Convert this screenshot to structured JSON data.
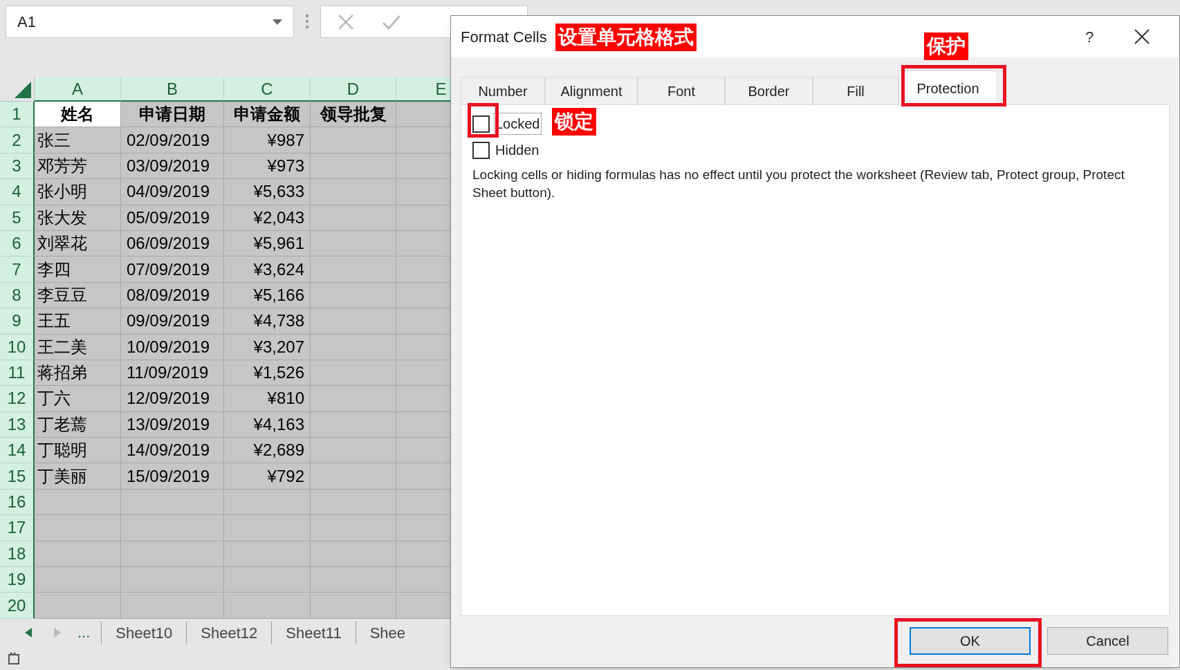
{
  "name_box": {
    "value": "A1"
  },
  "columns": [
    "A",
    "B",
    "C",
    "D",
    "E"
  ],
  "rows": [
    {
      "number": "1",
      "cells": [
        "姓名",
        "申请日期",
        "申请金额",
        "领导批复",
        ""
      ],
      "header": true
    },
    {
      "number": "2",
      "cells": [
        "张三",
        "02/09/2019",
        "¥987",
        "",
        ""
      ]
    },
    {
      "number": "3",
      "cells": [
        "邓芳芳",
        "03/09/2019",
        "¥973",
        "",
        ""
      ]
    },
    {
      "number": "4",
      "cells": [
        "张小明",
        "04/09/2019",
        "¥5,633",
        "",
        ""
      ]
    },
    {
      "number": "5",
      "cells": [
        "张大发",
        "05/09/2019",
        "¥2,043",
        "",
        ""
      ]
    },
    {
      "number": "6",
      "cells": [
        "刘翠花",
        "06/09/2019",
        "¥5,961",
        "",
        ""
      ]
    },
    {
      "number": "7",
      "cells": [
        "李四",
        "07/09/2019",
        "¥3,624",
        "",
        ""
      ]
    },
    {
      "number": "8",
      "cells": [
        "李豆豆",
        "08/09/2019",
        "¥5,166",
        "",
        ""
      ]
    },
    {
      "number": "9",
      "cells": [
        "王五",
        "09/09/2019",
        "¥4,738",
        "",
        ""
      ]
    },
    {
      "number": "10",
      "cells": [
        "王二美",
        "10/09/2019",
        "¥3,207",
        "",
        ""
      ]
    },
    {
      "number": "11",
      "cells": [
        "蒋招弟",
        "11/09/2019",
        "¥1,526",
        "",
        ""
      ]
    },
    {
      "number": "12",
      "cells": [
        "丁六",
        "12/09/2019",
        "¥810",
        "",
        ""
      ]
    },
    {
      "number": "13",
      "cells": [
        "丁老蔫",
        "13/09/2019",
        "¥4,163",
        "",
        ""
      ]
    },
    {
      "number": "14",
      "cells": [
        "丁聪明",
        "14/09/2019",
        "¥2,689",
        "",
        ""
      ]
    },
    {
      "number": "15",
      "cells": [
        "丁美丽",
        "15/09/2019",
        "¥792",
        "",
        ""
      ]
    },
    {
      "number": "16",
      "cells": [
        "",
        "",
        "",
        "",
        ""
      ]
    },
    {
      "number": "17",
      "cells": [
        "",
        "",
        "",
        "",
        ""
      ]
    },
    {
      "number": "18",
      "cells": [
        "",
        "",
        "",
        "",
        ""
      ]
    },
    {
      "number": "19",
      "cells": [
        "",
        "",
        "",
        "",
        ""
      ]
    },
    {
      "number": "20",
      "cells": [
        "",
        "",
        "",
        "",
        ""
      ]
    }
  ],
  "sheet_tabs": {
    "more": "...",
    "tabs": [
      "Sheet10",
      "Sheet12",
      "Sheet11",
      "Shee"
    ]
  },
  "dialog": {
    "title": "Format Cells",
    "help": "?",
    "tabs": [
      {
        "label": "Number",
        "selected": false
      },
      {
        "label": "Alignment",
        "selected": false
      },
      {
        "label": "Font",
        "selected": false
      },
      {
        "label": "Border",
        "selected": false
      },
      {
        "label": "Fill",
        "selected": false
      },
      {
        "label": "Protection",
        "selected": true
      }
    ],
    "options": [
      {
        "label": "Locked",
        "checked": false,
        "focused": true
      },
      {
        "label": "Hidden",
        "checked": false,
        "focused": false
      }
    ],
    "note": "Locking cells or hiding formulas has no effect until you protect the worksheet (Review tab, Protect group, Protect Sheet button).",
    "buttons": [
      {
        "label": "OK",
        "default": true
      },
      {
        "label": "Cancel",
        "default": false
      }
    ]
  },
  "annotations": [
    {
      "kind": "tag",
      "text": "设置单元格格式"
    },
    {
      "kind": "tag",
      "text": "保护"
    },
    {
      "kind": "frame"
    },
    {
      "kind": "frame"
    },
    {
      "kind": "tag",
      "text": "锁定"
    },
    {
      "kind": "frame"
    }
  ]
}
